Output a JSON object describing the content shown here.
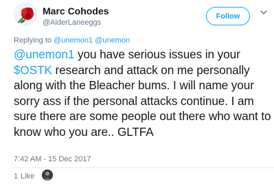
{
  "author": {
    "display_name": "Marc Cohodes",
    "screen_name": "@AlderLaneeggs",
    "avatar_colors": {
      "flower": "#d0121b",
      "petal_dark": "#8e0c12",
      "leaf": "#3f7a3a"
    }
  },
  "follow_button": {
    "label": "Follow"
  },
  "icons": {
    "caret": "chevron-down-icon"
  },
  "reply_to": {
    "prefix": "Replying to",
    "handles": [
      "@unemon1",
      "@unemon"
    ]
  },
  "tweet": {
    "mention": "@unemon1",
    "text_after_mention": " you have serious issues in your",
    "cashtag": "$OSTK",
    "text_after_cashtag": " research and attack on me personally along with the Bleacher bums. I will name your sorry ass if the personal attacks continue. I am sure there are some people out there who want to know who you are.. GLTFA"
  },
  "timestamp": "7:42 AM - 15 Dec 2017",
  "engagement": {
    "like_count": "1",
    "like_label": "Like"
  },
  "colors": {
    "link": "#1da1f2",
    "secondary_text": "#657786",
    "primary_text": "#14171a",
    "divider": "#e6ecf0"
  }
}
